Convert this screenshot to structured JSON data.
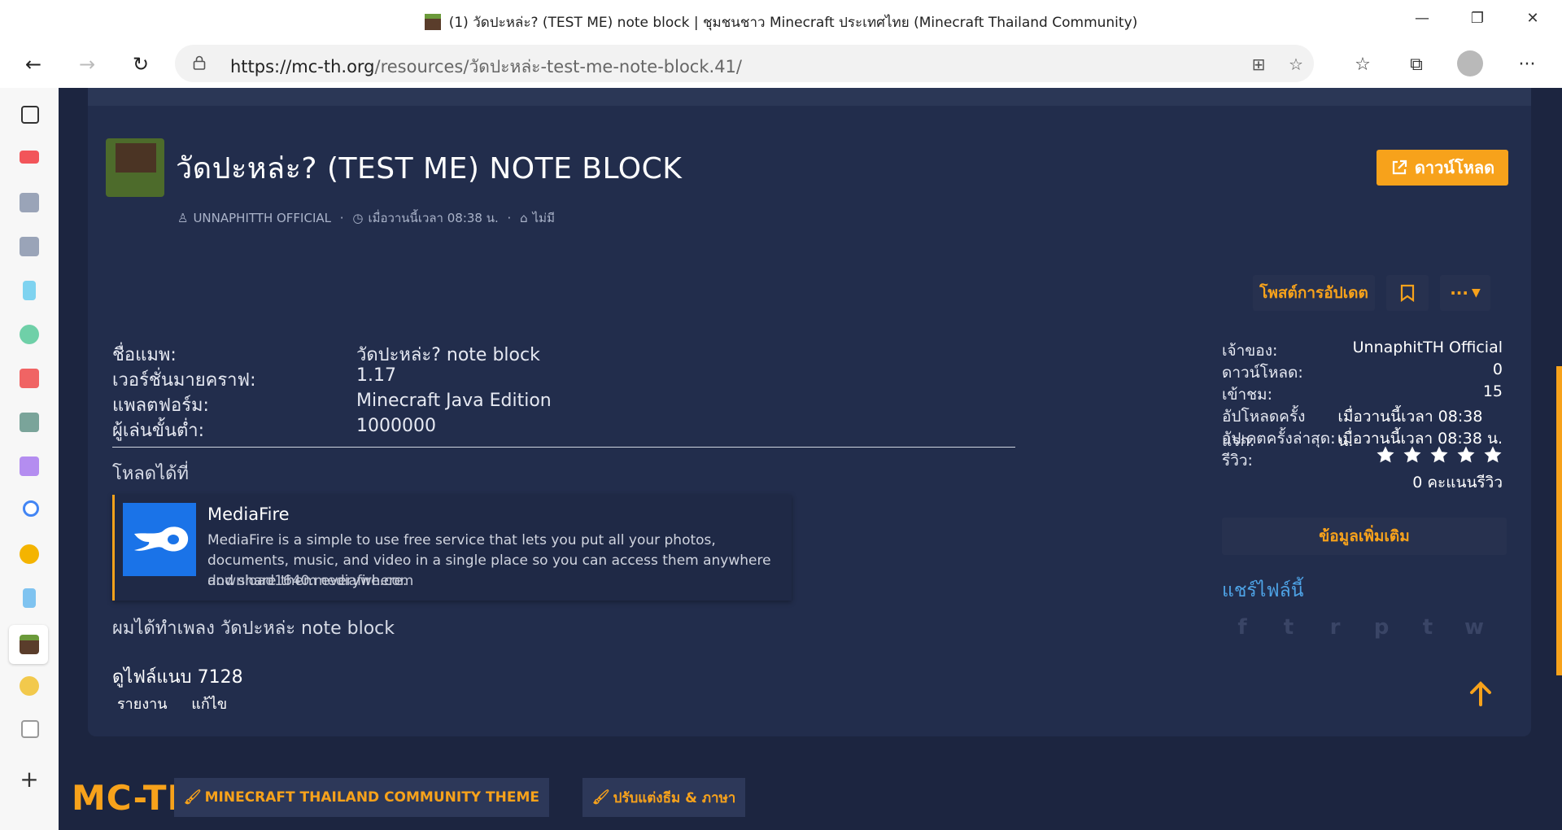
{
  "window": {
    "title": "(1) วัดปะหล่ะ? (TEST ME) note block | ชุมชนชาว Minecraft ประเทศไทย (Minecraft Thailand Community)",
    "minimize": "—",
    "maximize": "❐",
    "close": "✕"
  },
  "browser": {
    "url_host": "https://mc-th.org",
    "url_path": "/resources/วัดปะหล่ะ-test-me-note-block.41/",
    "back": "←",
    "forward": "→",
    "reload": "↻",
    "more": "···"
  },
  "resource": {
    "title": "วัดปะหล่ะ? (TEST ME) NOTE BLOCK",
    "author": "UNNAPHITTH OFFICIAL",
    "date": "เมื่อวานนี้เวลา 08:38 น.",
    "tags": "ไม่มี",
    "download_label": "ดาวน์โหลด",
    "post_update_label": "โพสต์การอัปเดต",
    "more_label": "···"
  },
  "fields": [
    {
      "label": "ชื่อแมพ:",
      "value": "วัดปะหล่ะ? note block"
    },
    {
      "label": "เวอร์ชั่นมายคราฟ:",
      "value": "1.17"
    },
    {
      "label": "แพลตฟอร์ม:",
      "value": "Minecraft Java Edition"
    },
    {
      "label": "ผู้เล่นขั้นต่ำ:",
      "value": "1000000"
    }
  ],
  "downloads": {
    "heading": "โหลดได้ที่",
    "card": {
      "name": "MediaFire",
      "description": "MediaFire is a simple to use free service that lets you put all your photos, documents, music, and video in a single place so you can access them anywhere and share them everywhere.",
      "domain": "download1640.mediafire.com"
    }
  },
  "description": "ผมได้ทำเพลง วัดปะหล่ะ note block",
  "views_label": "ดูไฟล์แนบ 7128",
  "actions": {
    "report": "รายงาน",
    "edit": "แก้ไข"
  },
  "info": [
    {
      "label": "เจ้าของ:",
      "value": "UnnaphitTH Official"
    },
    {
      "label": "ดาวน์โหลด:",
      "value": "0"
    },
    {
      "label": "เข้าชม:",
      "value": "15"
    },
    {
      "label": "อัปโหลดครั้งแรก:",
      "value": "เมื่อวานนี้เวลา 08:38 น."
    },
    {
      "label": "อัปเดตครั้งล่าสุด:",
      "value": "เมื่อวานนี้เวลา 08:38 น."
    },
    {
      "label": "รีวิว:",
      "value": ""
    }
  ],
  "rating": {
    "stars": 5,
    "filled": 0,
    "count_label": "0 คะแนนรีวิว"
  },
  "more_info_label": "ข้อมูลเพิ่มเติม",
  "share": {
    "heading": "แชร์ไฟล์นี้",
    "networks": [
      "f",
      "t",
      "r",
      "p",
      "t",
      "w"
    ]
  },
  "footer": {
    "logo": "MC-TH",
    "theme_label": "MINECRAFT THAILAND COMMUNITY THEME",
    "customize_label": "ปรับแต่งธีม & ภาษา"
  },
  "colors": {
    "accent": "#f7a21b",
    "page_bg": "#1c2540",
    "card_bg": "#222d4c",
    "link": "#4ea3e6"
  }
}
